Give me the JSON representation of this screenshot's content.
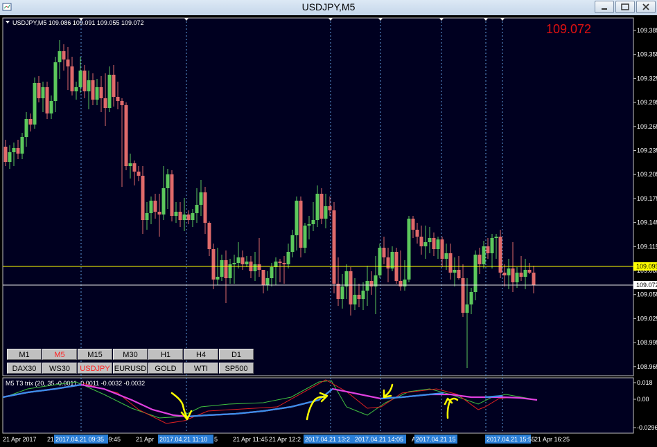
{
  "window": {
    "title": "USDJPY,M5"
  },
  "chart": {
    "header": "USDJPY,M5  109.086 109.091 109.055 109.072",
    "big_price": "109.072",
    "price_axis": [
      "109.385",
      "109.355",
      "109.325",
      "109.295",
      "109.265",
      "109.235",
      "109.205",
      "109.175",
      "109.145",
      "109.115",
      "109.085",
      "109.055",
      "109.025",
      "108.995",
      "108.965"
    ],
    "bid_label": "109.072",
    "ask_label": "109.095",
    "indicator_label": "M5 T3 trix (20, 35 -0.0011 -0.0011 -0.0032 -0.0032",
    "indicator_axis": [
      "0.018",
      "0.00",
      "-0.0296"
    ],
    "time_labels": [
      "21 Apr 2017",
      "21",
      "r 09:45",
      "21 Apr",
      "5",
      "21 Apr 11:45",
      "21 Apr 12:2",
      "A",
      "21 Apr 16:25"
    ],
    "time_highlights": [
      "2017.04.21 09:35",
      "2017.04.21 11:10",
      "2017.04.21 13:2",
      "2017.04.21 14:05",
      "2017.04.21 15",
      "2017.04.21 15:55"
    ],
    "timeframes": [
      {
        "label": "M1",
        "active": false
      },
      {
        "label": "M5",
        "active": true
      },
      {
        "label": "M15",
        "active": false
      },
      {
        "label": "M30",
        "active": false
      },
      {
        "label": "H1",
        "active": false
      },
      {
        "label": "H4",
        "active": false
      },
      {
        "label": "D1",
        "active": false
      }
    ],
    "symbols": [
      {
        "label": "DAX30",
        "active": false
      },
      {
        "label": "WS30",
        "active": false
      },
      {
        "label": "USDJPY",
        "active": true
      },
      {
        "label": "EURUSD",
        "active": false
      },
      {
        "label": "GOLD",
        "active": false
      },
      {
        "label": "WTI",
        "active": false
      },
      {
        "label": "SP500",
        "active": false
      }
    ]
  },
  "colors": {
    "bull": "#5cc85c",
    "bear": "#e06a6a",
    "background": "#000020",
    "ask_line": "#ffff00",
    "bid_line": "#ffffff",
    "big_price": "#e01010",
    "trix_magenta": "#e040e0",
    "trix_blue": "#3a8fe8",
    "signal_green": "#40c040",
    "signal_red": "#e02020",
    "annotation": "#ffff00",
    "vline": "#5f9ee0",
    "highlight": "#2a7fd8"
  }
}
